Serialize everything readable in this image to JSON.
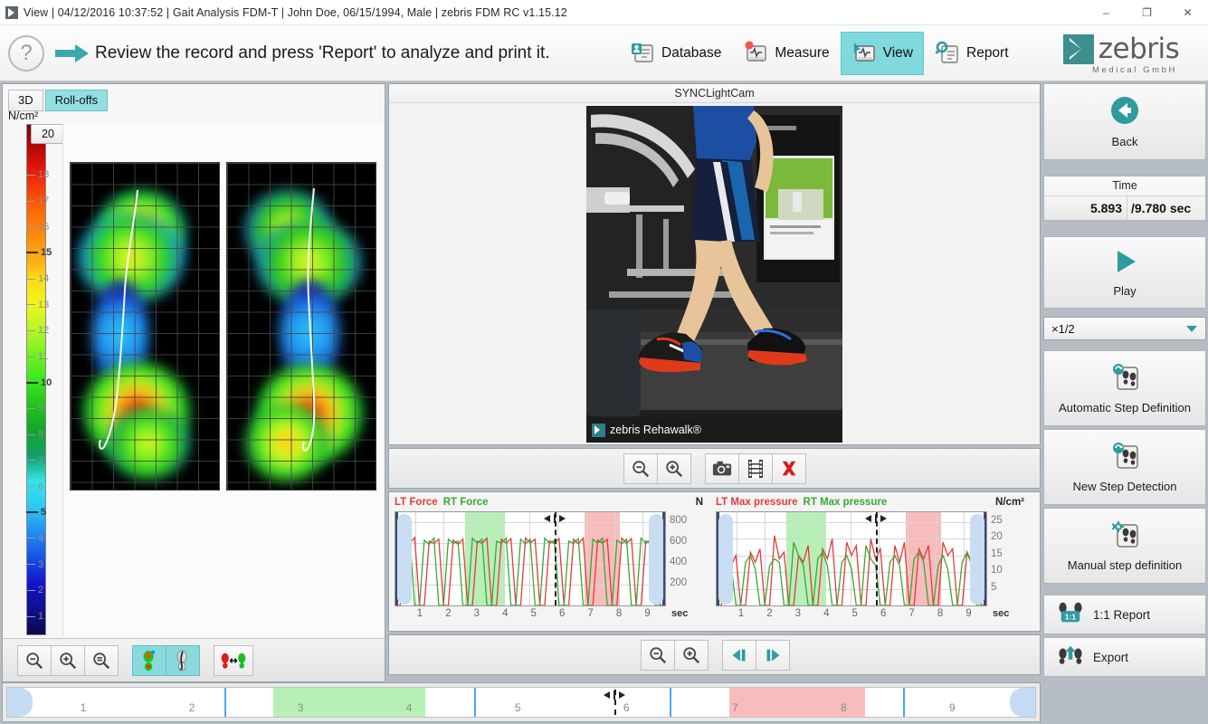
{
  "window": {
    "title": "View | 04/12/2016 10:37:52 | Gait Analysis FDM-T | John Doe, 06/15/1994, Male | zebris FDM RC v1.15.12",
    "minimize": "–",
    "restore": "❐",
    "close": "✕"
  },
  "header": {
    "help": "?",
    "instruction": "Review the record and press 'Report' to analyze and print it.",
    "tabs": [
      {
        "label": "Database",
        "icon": "database-icon",
        "active": false
      },
      {
        "label": "Measure",
        "icon": "measure-icon",
        "active": false
      },
      {
        "label": "View",
        "icon": "view-icon",
        "active": true
      },
      {
        "label": "Report",
        "icon": "report-icon",
        "active": false
      }
    ],
    "logo": {
      "text": "zebris",
      "sub": "Medical GmbH"
    }
  },
  "left_panel": {
    "tabs": [
      {
        "label": "3D",
        "active": false
      },
      {
        "label": "Roll-offs",
        "active": true
      }
    ],
    "colorbar": {
      "unit": "N/cm²",
      "max_value": "20",
      "ticks": [
        "18",
        "17",
        "16",
        "15",
        "14",
        "13",
        "12",
        "11",
        "10",
        "9",
        "8",
        "7",
        "6",
        "5",
        "4",
        "3",
        "2",
        "1"
      ],
      "bold_ticks": [
        "15",
        "10",
        "5"
      ]
    },
    "toolbar": [
      {
        "name": "zoom-out-button",
        "icon": "zoom-out-icon",
        "active": false
      },
      {
        "name": "zoom-in-button",
        "icon": "zoom-in-icon",
        "active": false
      },
      {
        "name": "zoom-fit-button",
        "icon": "zoom-fit-icon",
        "active": false
      },
      {
        "name": "pressure-view-button",
        "icon": "foot-pressure-icon",
        "active": true
      },
      {
        "name": "cop-view-button",
        "icon": "foot-cop-icon",
        "active": true
      },
      {
        "name": "swap-feet-button",
        "icon": "swap-feet-icon",
        "active": false
      }
    ]
  },
  "video": {
    "title": "SYNCLightCam",
    "watermark": "zebris Rehawalk®",
    "toolbar": [
      {
        "name": "video-zoom-out-button",
        "icon": "zoom-out-icon"
      },
      {
        "name": "video-zoom-in-button",
        "icon": "zoom-in-icon"
      },
      {
        "name": "snapshot-button",
        "icon": "camera-icon"
      },
      {
        "name": "film-button",
        "icon": "film-strip-icon"
      },
      {
        "name": "delete-button",
        "icon": "red-x-icon"
      }
    ]
  },
  "playback_toolbar": [
    {
      "name": "chart-zoom-out-button",
      "icon": "zoom-out-icon"
    },
    {
      "name": "chart-zoom-in-button",
      "icon": "zoom-in-icon"
    },
    {
      "name": "step-back-button",
      "icon": "step-back-icon"
    },
    {
      "name": "step-forward-button",
      "icon": "step-forward-icon"
    }
  ],
  "sidebar": {
    "back": {
      "label": "Back",
      "icon": "back-arrow-icon"
    },
    "time": {
      "header": "Time",
      "current": "5.893",
      "total": "/9.780 sec"
    },
    "play": {
      "label": "Play",
      "icon": "play-icon"
    },
    "speed": {
      "value": "×1/2",
      "icon": "chevron-down-icon"
    },
    "buttons": [
      {
        "label": "Automatic Step Definition",
        "icon": "auto-step-icon"
      },
      {
        "label": "New Step Detection",
        "icon": "new-step-icon"
      },
      {
        "label": "Manual step definition",
        "icon": "manual-step-icon"
      }
    ],
    "report": {
      "label": "1:1 Report",
      "icon": "report-1to1-icon"
    },
    "export": {
      "label": "Export",
      "icon": "export-icon"
    }
  },
  "chart_data": [
    {
      "type": "line",
      "title": "LT Force  RT Force",
      "series": [
        {
          "name": "LT Force",
          "color": "#e23b3b",
          "values": [
            0,
            0,
            640,
            600,
            655,
            0,
            0,
            620,
            600,
            640,
            0,
            0,
            630,
            590,
            640,
            0,
            0,
            620,
            600,
            650,
            0,
            0,
            640,
            600,
            645,
            0,
            0,
            650,
            605,
            640,
            0,
            0,
            625,
            600,
            645,
            0,
            0,
            640,
            595,
            650,
            0,
            0,
            630,
            600,
            640,
            0,
            0,
            650,
            600,
            645,
            0,
            0,
            620,
            600,
            640,
            0,
            0
          ]
        },
        {
          "name": "RT Force",
          "color": "#3aa832",
          "values": [
            0,
            650,
            600,
            640,
            0,
            0,
            630,
            590,
            650,
            0,
            0,
            640,
            600,
            620,
            0,
            0,
            650,
            600,
            640,
            0,
            0,
            620,
            600,
            650,
            0,
            0,
            640,
            595,
            640,
            0,
            0,
            650,
            600,
            630,
            0,
            0,
            620,
            600,
            645,
            0,
            0,
            640,
            600,
            650,
            0,
            0,
            630,
            595,
            640,
            0,
            0,
            650,
            600,
            640,
            0,
            0,
            0
          ]
        }
      ],
      "ylabel": "N",
      "yticks": [
        800,
        600,
        400,
        200
      ],
      "ylim": [
        0,
        900
      ],
      "xlabel": "sec",
      "xticks": [
        1,
        2,
        3,
        4,
        5,
        6,
        7,
        8,
        9
      ],
      "xlim": [
        0.3,
        9.78
      ],
      "zones": [
        {
          "type": "green",
          "start": 2.75,
          "end": 4.15
        },
        {
          "type": "red",
          "start": 6.95,
          "end": 8.2
        }
      ],
      "cursor": 5.893
    },
    {
      "type": "line",
      "title": "LT Max pressure  RT Max pressure",
      "series": [
        {
          "name": "LT Max pressure",
          "color": "#e23b3b",
          "values": [
            0,
            0,
            14,
            12,
            15,
            0,
            0,
            16,
            13,
            17,
            0,
            0,
            21,
            14,
            16,
            0,
            0,
            15,
            13,
            18,
            0,
            0,
            17,
            14,
            20,
            0,
            0,
            19,
            15,
            18,
            0,
            0,
            20,
            14,
            17,
            0,
            0,
            18,
            13,
            19,
            0,
            0,
            17,
            14,
            18,
            0,
            0,
            19,
            15,
            17,
            0,
            0,
            16,
            13,
            18,
            0,
            0
          ]
        },
        {
          "name": "RT Max pressure",
          "color": "#3aa832",
          "values": [
            0,
            11,
            14,
            12,
            0,
            0,
            13,
            15,
            11,
            0,
            0,
            12,
            14,
            13,
            0,
            0,
            19,
            15,
            12,
            0,
            0,
            14,
            16,
            12,
            0,
            0,
            13,
            15,
            11,
            0,
            0,
            18,
            14,
            12,
            0,
            0,
            13,
            15,
            12,
            0,
            0,
            14,
            16,
            13,
            0,
            0,
            12,
            15,
            11,
            0,
            0,
            13,
            16,
            12,
            0,
            0,
            0
          ]
        }
      ],
      "ylabel": "N/cm²",
      "yticks": [
        25,
        20,
        15,
        10,
        5
      ],
      "ylim": [
        0,
        28
      ],
      "xlabel": "sec",
      "xticks": [
        1,
        2,
        3,
        4,
        5,
        6,
        7,
        8,
        9
      ],
      "xlim": [
        0.3,
        9.78
      ],
      "zones": [
        {
          "type": "green",
          "start": 2.75,
          "end": 4.15
        },
        {
          "type": "red",
          "start": 6.95,
          "end": 8.2
        }
      ],
      "cursor": 5.893
    }
  ],
  "timeline": {
    "ticks": [
      1,
      2,
      3,
      4,
      5,
      6,
      7,
      8,
      9
    ],
    "range": [
      0.3,
      9.78
    ],
    "zones": [
      {
        "type": "green",
        "start": 2.75,
        "end": 4.15
      },
      {
        "type": "red",
        "start": 6.95,
        "end": 8.2
      }
    ],
    "markers": [
      2.3,
      4.6,
      6.4,
      8.55
    ],
    "cursor": 5.893
  }
}
